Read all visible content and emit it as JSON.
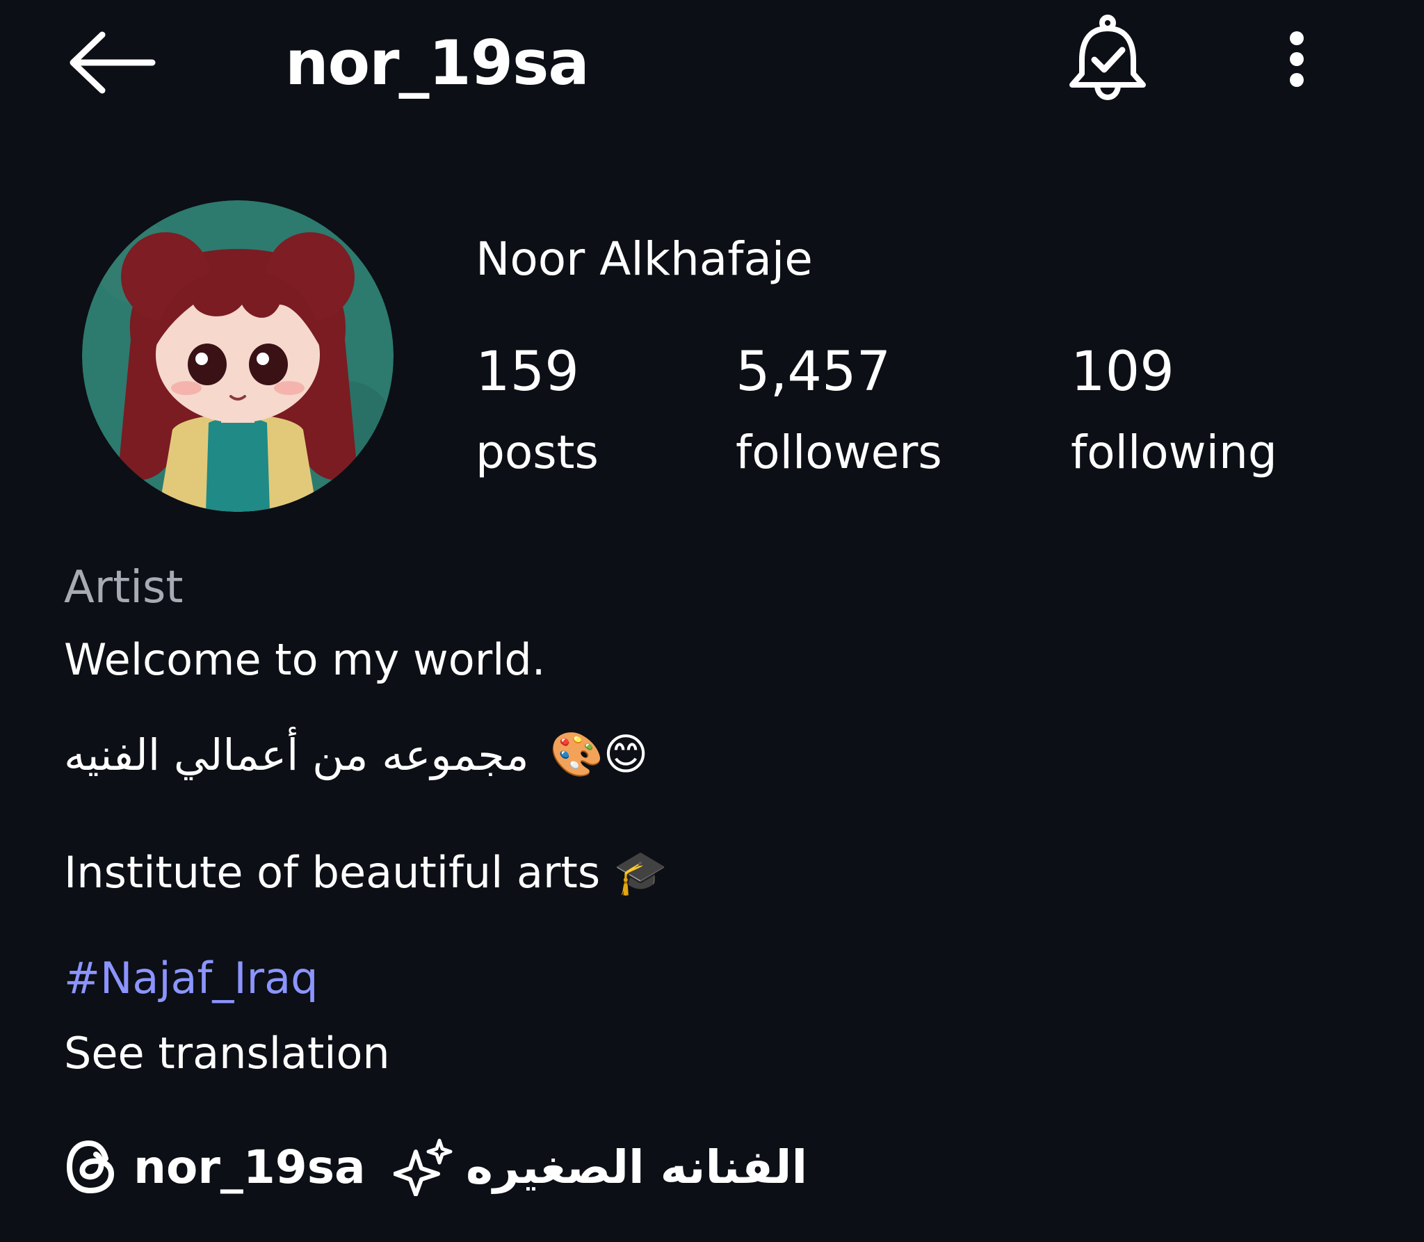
{
  "header": {
    "username": "nor_19sa",
    "back_icon": "arrow-left-icon",
    "bell_icon": "bell-check-icon",
    "more_icon": "more-vertical-icon"
  },
  "profile": {
    "avatar_icon": "cartoon-girl-avatar",
    "display_name": "Noor Alkhafaje",
    "stats": [
      {
        "value": "159",
        "label": "posts"
      },
      {
        "value": "5,457",
        "label": "followers"
      },
      {
        "value": "109",
        "label": "following"
      }
    ]
  },
  "bio": {
    "category": "Artist",
    "line1": "Welcome to my world.",
    "line2_text": "مجموعه من  أعمالي الفنيه",
    "line2_emoji": "🎨😊",
    "line3_text": "Institute of beautiful arts",
    "line3_emoji": "🎓",
    "hashtag": "#Najaf_Iraq",
    "see_translation": "See translation"
  },
  "links": {
    "threads_icon": "threads-icon",
    "threads_handle": "nor_19sa",
    "sparkle_icon": "sparkle-icon",
    "arabic_title": "الفنانه الصغيره"
  },
  "colors": {
    "background": "#0c0f15",
    "text": "#ffffff",
    "muted": "#a7abb3",
    "hashtag": "#8c95ff"
  }
}
